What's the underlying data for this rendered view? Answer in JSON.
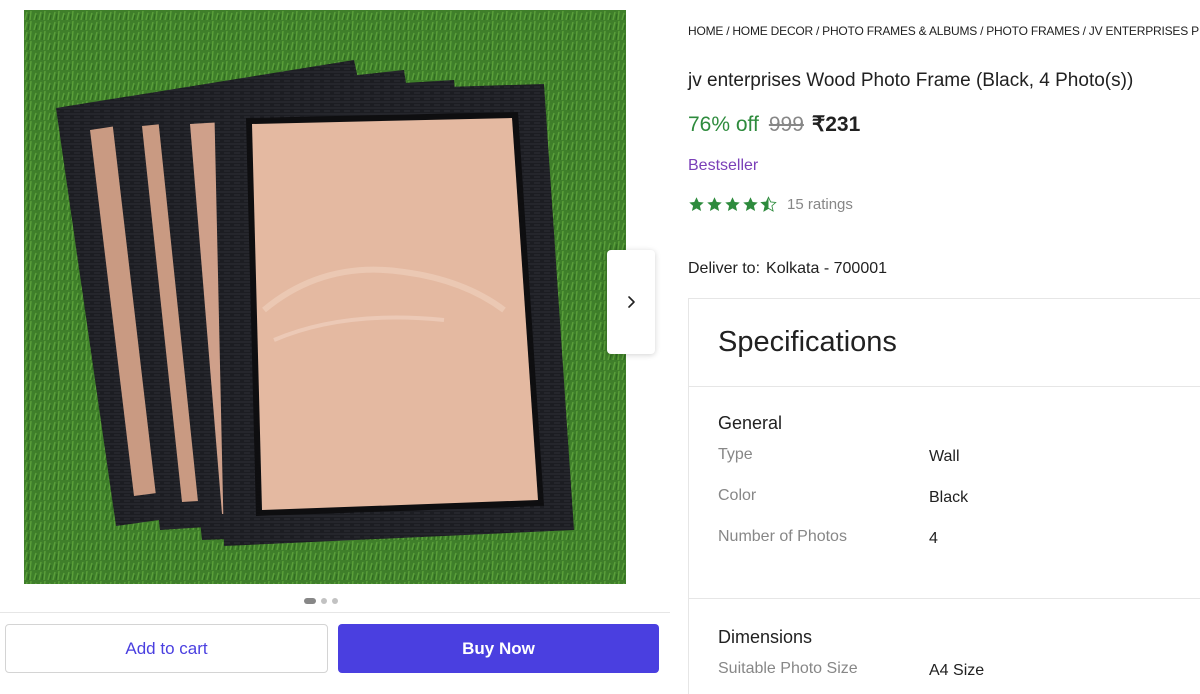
{
  "gallery": {
    "image_alt": "Four black wooden photo frames on green grass",
    "next_icon": "chevron-right-icon",
    "dots_count": 3,
    "active_dot": 0
  },
  "actions": {
    "add_to_cart": "Add to cart",
    "buy_now": "Buy Now"
  },
  "breadcrumb": [
    "HOME",
    "HOME DECOR",
    "PHOTO FRAMES & ALBUMS",
    "PHOTO FRAMES",
    "JV ENTERPRISES P"
  ],
  "product": {
    "title": "jv enterprises Wood Photo Frame (Black, 4 Photo(s))",
    "discount": "76% off",
    "mrp": "999",
    "price": "₹231",
    "badge": "Bestseller",
    "rating_stars": 4.5,
    "ratings_count": "15 ratings"
  },
  "delivery": {
    "label": "Deliver to:",
    "location": "Kolkata - 700001"
  },
  "specifications": {
    "heading": "Specifications",
    "general": {
      "title": "General",
      "rows": [
        {
          "key": "Type",
          "value": "Wall"
        },
        {
          "key": "Color",
          "value": "Black"
        },
        {
          "key": "Number of Photos",
          "value": "4"
        }
      ]
    },
    "dimensions": {
      "title": "Dimensions",
      "rows": [
        {
          "key": "Suitable Photo Size",
          "value": "A4 Size"
        }
      ]
    }
  },
  "colors": {
    "accent": "#4a3fe0",
    "discount_green": "#2e8b3d",
    "star_green": "#2e8b3d",
    "bestseller_purple": "#7a3fb8",
    "muted_text": "#878787"
  }
}
